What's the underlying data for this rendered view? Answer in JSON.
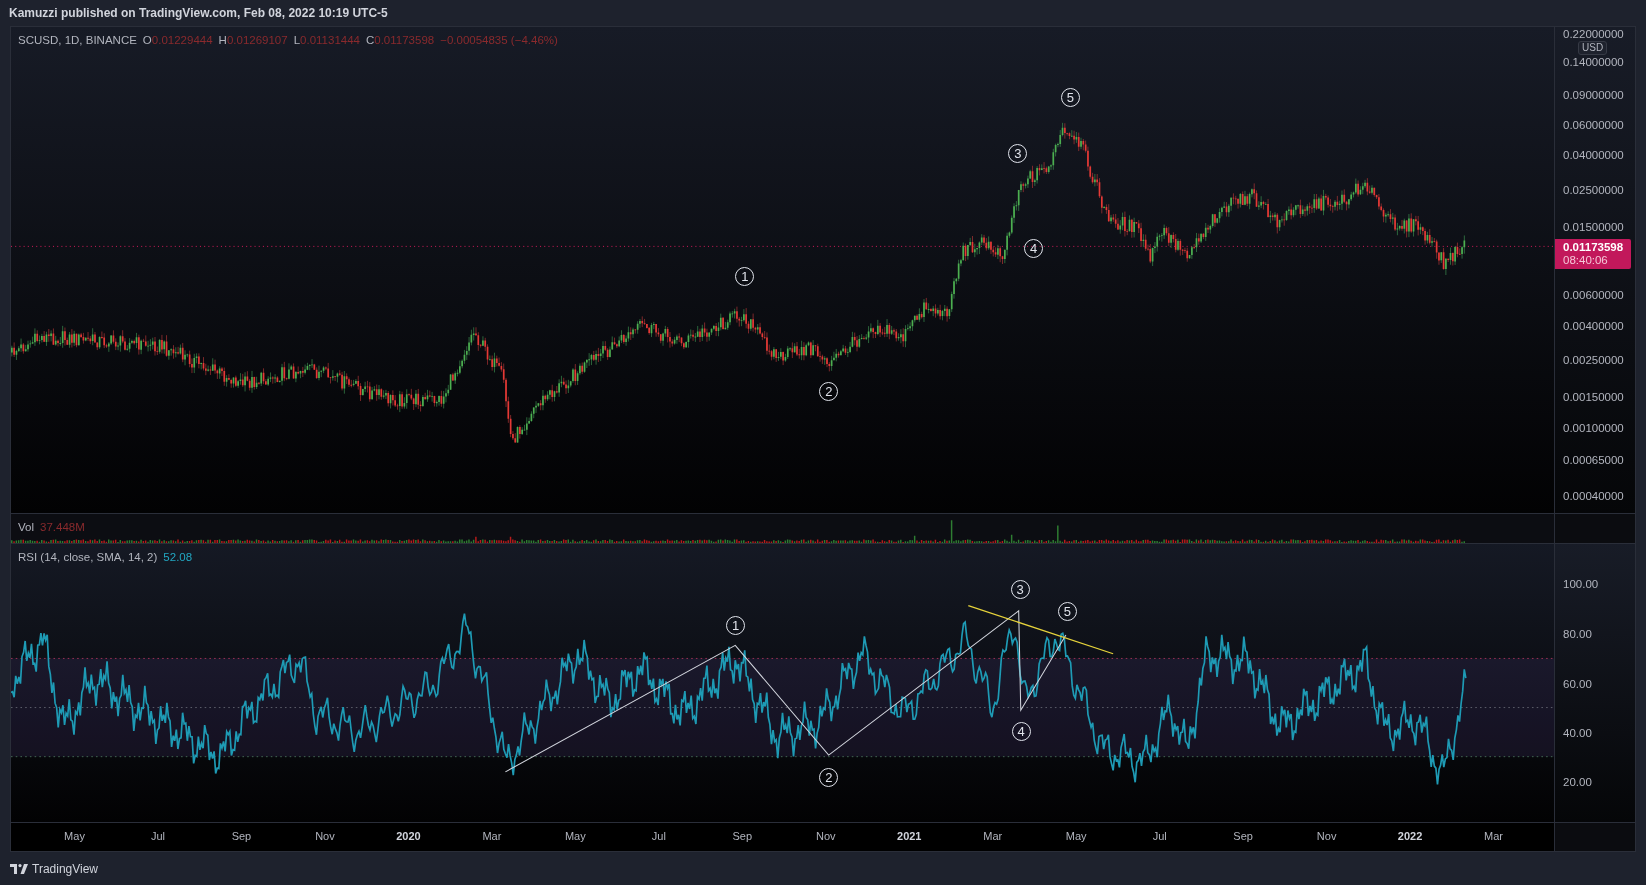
{
  "header": {
    "text": "Kamuzzi published on TradingView.com, Feb 08, 2022 10:19 UTC-5"
  },
  "legend": {
    "symbol": "SCUSD, 1D, BINANCE",
    "values": [
      {
        "key": "O",
        "value": "0.01229444"
      },
      {
        "key": "H",
        "value": "0.01269107"
      },
      {
        "key": "L",
        "value": "0.01131444"
      },
      {
        "key": "C",
        "value": "0.01173598"
      }
    ],
    "change": "−0.00054835 (−4.46%)"
  },
  "price_axis": {
    "labels": [
      "0.22000000",
      "0.14000000",
      "0.09000000",
      "0.06000000",
      "0.04000000",
      "0.02500000",
      "0.01500000",
      "0.00600000",
      "0.00400000",
      "0.00250000",
      "0.00150000",
      "0.00100000",
      "0.00065000",
      "0.00040000"
    ],
    "currency": "USD",
    "last_price": "0.01173598",
    "countdown": "08:40:06"
  },
  "wave_labels": [
    "1",
    "2",
    "3",
    "4",
    "5"
  ],
  "volume": {
    "label": "Vol",
    "value": "37.448M"
  },
  "rsi": {
    "label": "RSI (14, close, SMA, 14, 2)",
    "value": "52.08",
    "axis_labels": [
      "100.00",
      "80.00",
      "60.00",
      "40.00",
      "20.00"
    ],
    "wave_labels": [
      "1",
      "2",
      "3",
      "4",
      "5"
    ]
  },
  "time_axis": [
    {
      "label": "May",
      "kind": "month"
    },
    {
      "label": "Jul",
      "kind": "month"
    },
    {
      "label": "Sep",
      "kind": "month"
    },
    {
      "label": "Nov",
      "kind": "month"
    },
    {
      "label": "2020",
      "kind": "year"
    },
    {
      "label": "Mar",
      "kind": "month"
    },
    {
      "label": "May",
      "kind": "month"
    },
    {
      "label": "Jul",
      "kind": "month"
    },
    {
      "label": "Sep",
      "kind": "month"
    },
    {
      "label": "Nov",
      "kind": "month"
    },
    {
      "label": "2021",
      "kind": "year"
    },
    {
      "label": "Mar",
      "kind": "month"
    },
    {
      "label": "May",
      "kind": "month"
    },
    {
      "label": "Jul",
      "kind": "month"
    },
    {
      "label": "Sep",
      "kind": "month"
    },
    {
      "label": "Nov",
      "kind": "month"
    },
    {
      "label": "2022",
      "kind": "year"
    },
    {
      "label": "Mar",
      "kind": "month"
    }
  ],
  "footer": {
    "brand": "TradingView"
  }
}
